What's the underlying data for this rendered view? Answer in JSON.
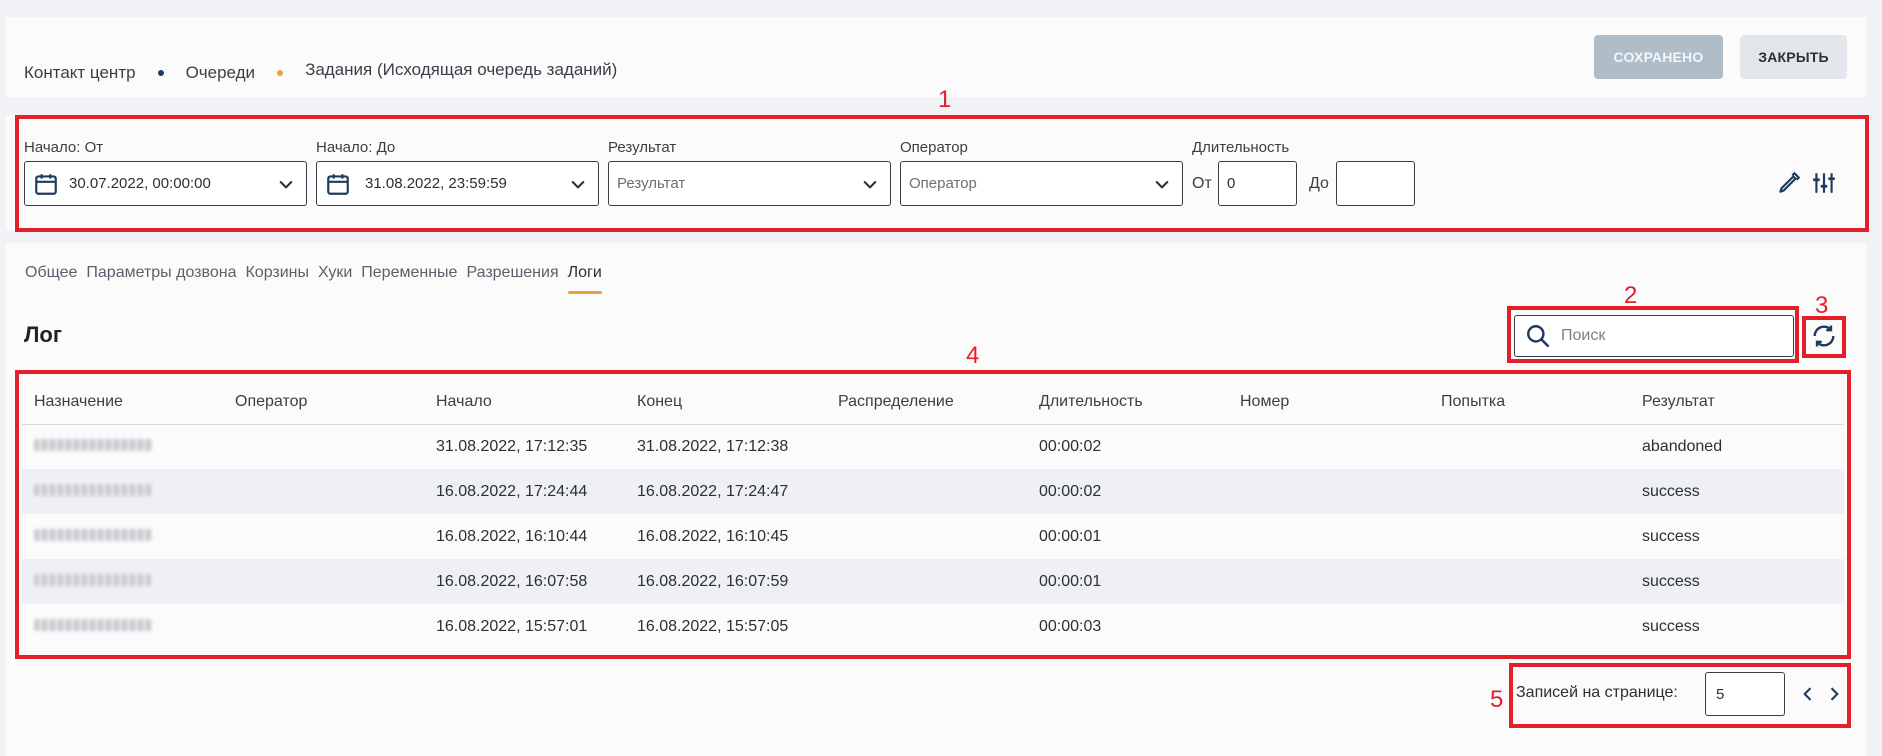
{
  "breadcrumbs": [
    {
      "label": "Контакт центр"
    },
    {
      "label": "Очереди"
    },
    {
      "label": "Задания (Исходящая очередь заданий)"
    }
  ],
  "breadcrumb_colors": {
    "dot1": "#1f3a5f",
    "dot2": "#e8a33d"
  },
  "header_buttons": {
    "saved": "СОХРАНЕНО",
    "close": "ЗАКРЫТЬ"
  },
  "filters": {
    "start_from": {
      "label": "Начало: От",
      "value": "30.07.2022, 00:00:00"
    },
    "start_to": {
      "label": "Начало: До",
      "value": "31.08.2022, 23:59:59"
    },
    "result": {
      "label": "Результат",
      "placeholder": "Результат"
    },
    "operator": {
      "label": "Оператор",
      "placeholder": "Оператор"
    },
    "duration": {
      "label": "Длительность",
      "from_label": "От",
      "from_value": "0",
      "to_label": "До",
      "to_value": ""
    }
  },
  "tabs": [
    "Общее",
    "Параметры дозвона",
    "Корзины",
    "Хуки",
    "Переменные",
    "Разрешения",
    "Логи"
  ],
  "active_tab": "Логи",
  "log": {
    "title": "Лог",
    "search_placeholder": "Поиск",
    "columns": [
      "Назначение",
      "Оператор",
      "Начало",
      "Конец",
      "Распределение",
      "Длительность",
      "Номер",
      "Попытка",
      "Результат"
    ],
    "rows": [
      {
        "start": "31.08.2022, 17:12:35",
        "end": "31.08.2022, 17:12:38",
        "duration": "00:00:02",
        "result": "abandoned"
      },
      {
        "start": "16.08.2022, 17:24:44",
        "end": "16.08.2022, 17:24:47",
        "duration": "00:00:02",
        "result": "success"
      },
      {
        "start": "16.08.2022, 16:10:44",
        "end": "16.08.2022, 16:10:45",
        "duration": "00:00:01",
        "result": "success"
      },
      {
        "start": "16.08.2022, 16:07:58",
        "end": "16.08.2022, 16:07:59",
        "duration": "00:00:01",
        "result": "success"
      },
      {
        "start": "16.08.2022, 15:57:01",
        "end": "16.08.2022, 15:57:05",
        "duration": "00:00:03",
        "result": "success"
      }
    ]
  },
  "pagination": {
    "label": "Записей на странице:",
    "per_page": "5"
  },
  "annotations": [
    "1",
    "2",
    "3",
    "4",
    "5"
  ],
  "accent_color": "#e2202c"
}
